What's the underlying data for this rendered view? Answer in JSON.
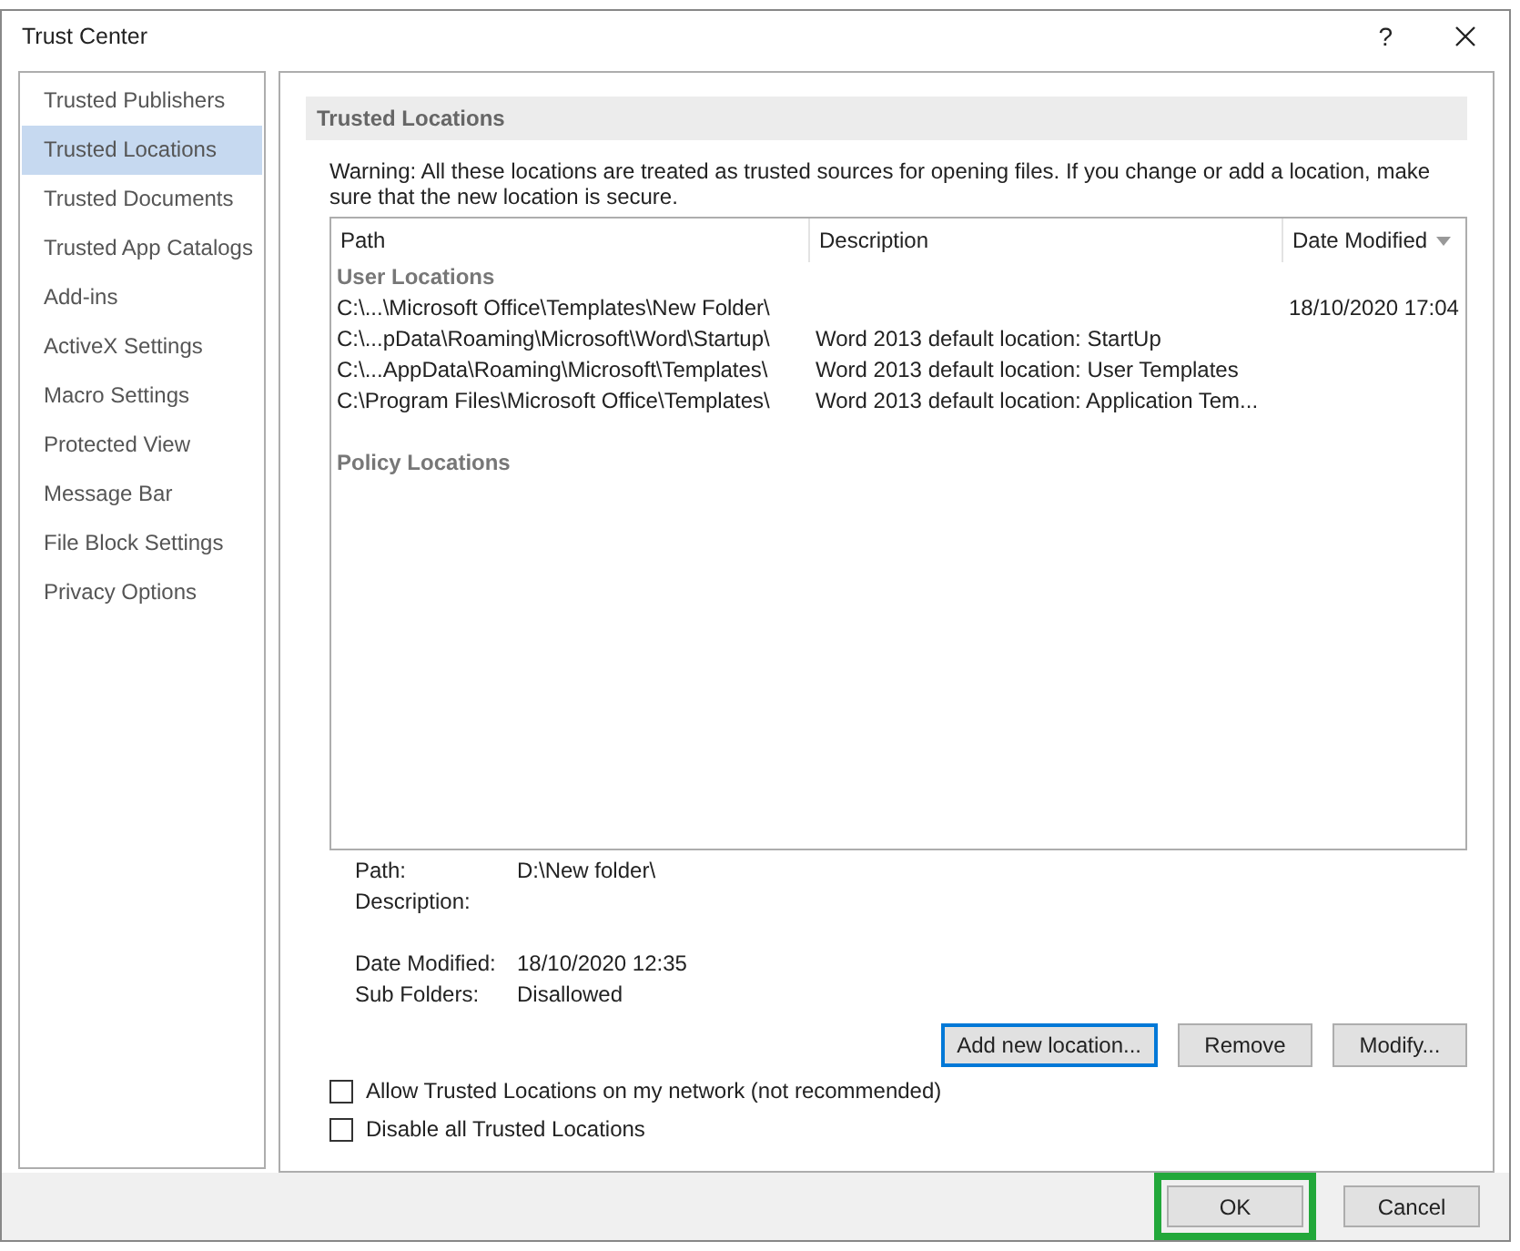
{
  "window": {
    "title": "Trust Center",
    "help": "?"
  },
  "sidebar": {
    "items": [
      {
        "label": "Trusted Publishers",
        "selected": false
      },
      {
        "label": "Trusted Locations",
        "selected": true
      },
      {
        "label": "Trusted Documents",
        "selected": false
      },
      {
        "label": "Trusted App Catalogs",
        "selected": false
      },
      {
        "label": "Add-ins",
        "selected": false
      },
      {
        "label": "ActiveX Settings",
        "selected": false
      },
      {
        "label": "Macro Settings",
        "selected": false
      },
      {
        "label": "Protected View",
        "selected": false
      },
      {
        "label": "Message Bar",
        "selected": false
      },
      {
        "label": "File Block Settings",
        "selected": false
      },
      {
        "label": "Privacy Options",
        "selected": false
      }
    ]
  },
  "section": {
    "title": "Trusted Locations",
    "warning": "Warning: All these locations are treated as trusted sources for opening files.  If you change or add a location, make sure that the new location is secure."
  },
  "table": {
    "columns": [
      {
        "label": "Path",
        "sorted": false
      },
      {
        "label": "Description",
        "sorted": false
      },
      {
        "label": "Date Modified",
        "sorted": true
      }
    ],
    "groups": [
      {
        "label": "User Locations",
        "rows": [
          {
            "path": "C:\\...\\Microsoft Office\\Templates\\New Folder\\",
            "description": "",
            "date_modified": "18/10/2020 17:04"
          },
          {
            "path": "C:\\...pData\\Roaming\\Microsoft\\Word\\Startup\\",
            "description": "Word 2013 default location: StartUp",
            "date_modified": ""
          },
          {
            "path": "C:\\...AppData\\Roaming\\Microsoft\\Templates\\",
            "description": "Word 2013 default location: User Templates",
            "date_modified": ""
          },
          {
            "path": "C:\\Program Files\\Microsoft Office\\Templates\\",
            "description": "Word 2013 default location: Application Tem...",
            "date_modified": ""
          }
        ]
      },
      {
        "label": "Policy Locations"
      }
    ]
  },
  "details": [
    {
      "label": "Path:",
      "value": "D:\\New folder\\"
    },
    {
      "label": "Description:"
    },
    {
      "label": "Date Modified:",
      "value": "18/10/2020 12:35"
    },
    {
      "label": "Sub Folders:",
      "value": "Disallowed"
    }
  ],
  "buttons": [
    {
      "label": "Add new location...",
      "focused": true
    },
    {
      "label": "Remove",
      "focused": false
    },
    {
      "label": "Modify...",
      "focused": false
    }
  ],
  "checkboxes": [
    {
      "label": "Allow Trusted Locations on my network (not recommended)",
      "checked": false
    },
    {
      "label": "Disable all Trusted Locations",
      "checked": false
    }
  ],
  "footer_buttons": [
    {
      "label": "OK",
      "highlighted": true
    },
    {
      "label": "Cancel",
      "highlighted": false
    }
  ]
}
